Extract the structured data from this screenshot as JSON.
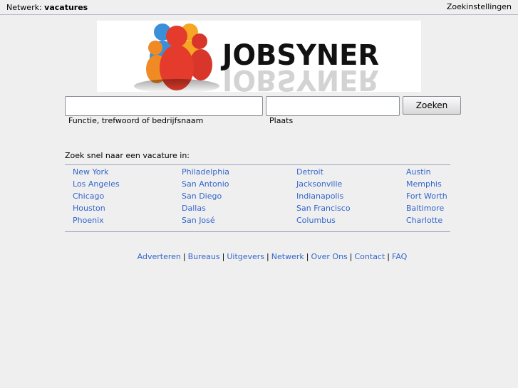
{
  "topbar": {
    "network_prefix": "Netwerk:",
    "network_name": "vacatures",
    "settings_label": "Zoekinstellingen"
  },
  "logo": {
    "text": "JOBSYNER",
    "people_colors": [
      "#3a8fd8",
      "#f5a623",
      "#e53b2c",
      "#f08a24",
      "#d8362a"
    ]
  },
  "search": {
    "what_value": "",
    "what_hint": "Functie, trefwoord of bedrijfsnaam",
    "where_value": "",
    "where_hint": "Plaats",
    "button_label": "Zoeken"
  },
  "quick": {
    "title": "Zoek snel naar een vacature in:",
    "columns": [
      [
        "New York",
        "Los Angeles",
        "Chicago",
        "Houston",
        "Phoenix"
      ],
      [
        "Philadelphia",
        "San Antonio",
        "San Diego",
        "Dallas",
        "San José"
      ],
      [
        "Detroit",
        "Jacksonville",
        "Indianapolis",
        "San Francisco",
        "Columbus"
      ],
      [
        "Austin",
        "Memphis",
        "Fort Worth",
        "Baltimore",
        "Charlotte"
      ]
    ]
  },
  "footer": {
    "links": [
      "Adverteren",
      "Bureaus",
      "Uitgevers",
      "Netwerk",
      "Over Ons",
      "Contact",
      "FAQ"
    ],
    "separator": "|"
  },
  "colors": {
    "link": "#3366cc",
    "background": "#efefef"
  }
}
